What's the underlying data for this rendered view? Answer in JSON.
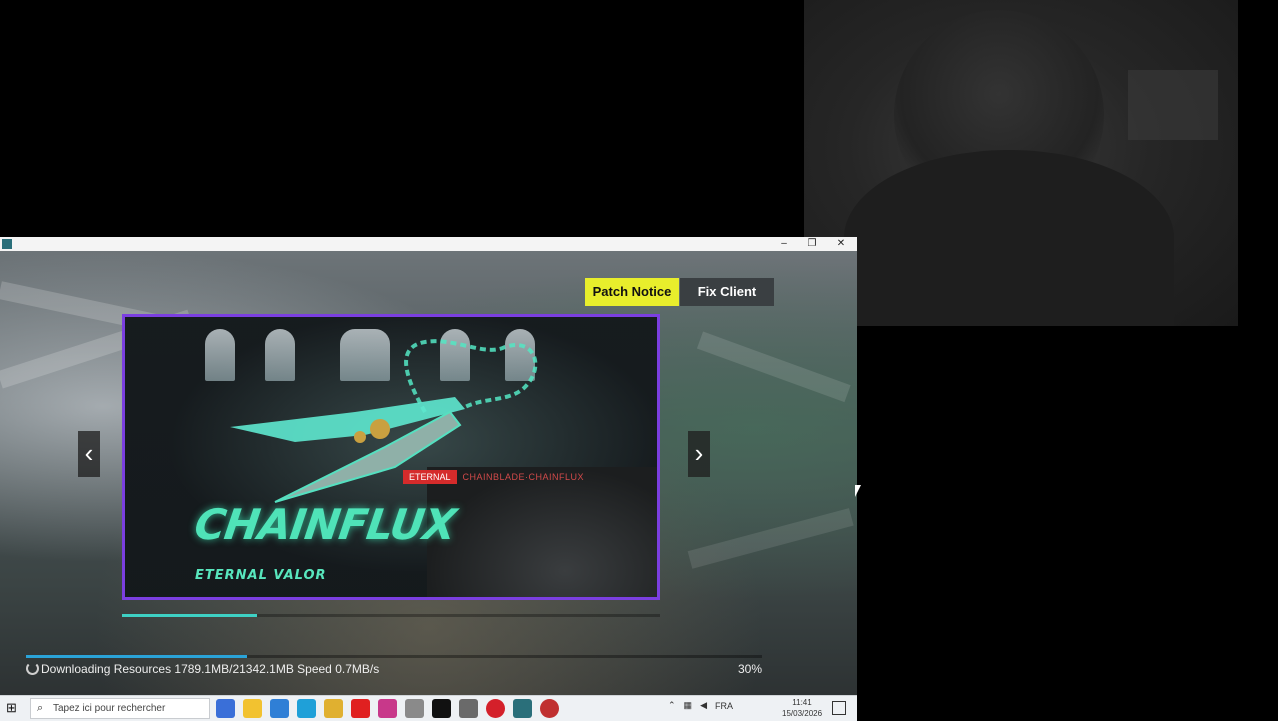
{
  "window": {
    "minimize_glyph": "–",
    "maximize_glyph": "❐",
    "close_glyph": "✕"
  },
  "header_buttons": {
    "patch_notice": "Patch Notice",
    "fix_client": "Fix Client"
  },
  "banner": {
    "logo_text": "CHAINFLUX",
    "subtitle": "ETERNAL VALOR",
    "tag_label": "ETERNAL",
    "tag_sub": "CHAINBLADE·CHAINFLUX",
    "progress": 0.25
  },
  "carousel": {
    "prev_glyph": "‹",
    "next_glyph": "›"
  },
  "download": {
    "status_text": "Downloading Resources 1789.1MB/21342.1MB  Speed 0.7MB/s",
    "percent_text": "30%",
    "progress": 0.3
  },
  "taskbar": {
    "start_glyph": "⊞",
    "search_placeholder": "Tapez ici pour rechercher",
    "tray_lang": "FRA",
    "clock_time": "11:41",
    "clock_date": "15/03/2026",
    "colors": {
      "accent_yellow": "#e8ee2c",
      "banner_border": "#7b3fe0",
      "download_fill": "#2aa3d8"
    }
  }
}
